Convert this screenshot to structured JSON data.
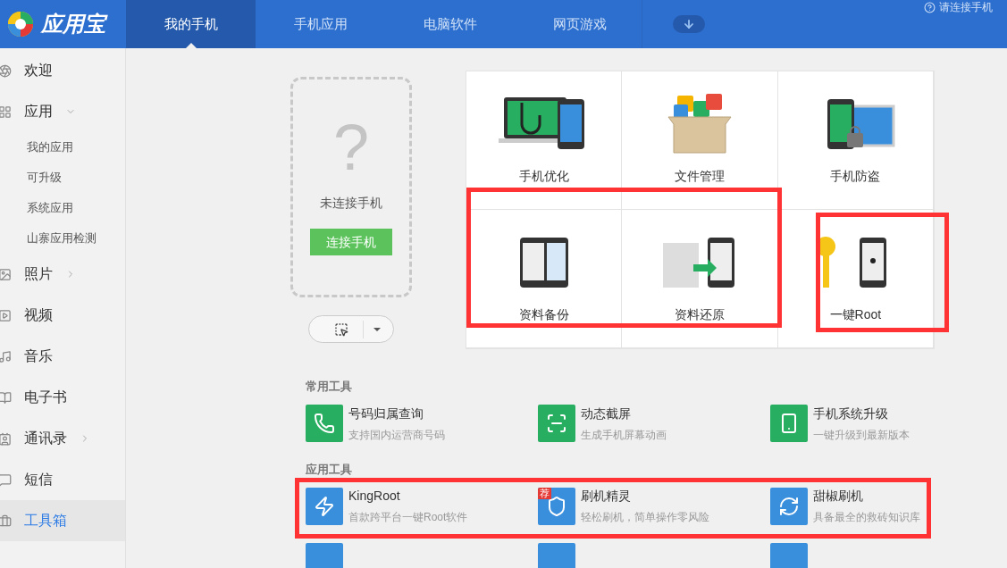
{
  "logo": {
    "text": "应用宝"
  },
  "tabs": [
    {
      "label": "我的手机",
      "selected": true
    },
    {
      "label": "手机应用",
      "selected": false
    },
    {
      "label": "电脑软件",
      "selected": false
    },
    {
      "label": "网页游戏",
      "selected": false
    }
  ],
  "header_right": {
    "text": "请连接手机"
  },
  "sidebar": {
    "items": [
      {
        "label": "欢迎",
        "selected": false
      },
      {
        "label": "应用",
        "selected": false,
        "expanded": true,
        "children": [
          {
            "label": "我的应用"
          },
          {
            "label": "可升级"
          },
          {
            "label": "系统应用"
          },
          {
            "label": "山寨应用检测"
          }
        ]
      },
      {
        "label": "照片",
        "selected": false,
        "expanded": false
      },
      {
        "label": "视频",
        "selected": false
      },
      {
        "label": "音乐",
        "selected": false
      },
      {
        "label": "电子书",
        "selected": false
      },
      {
        "label": "通讯录",
        "selected": false,
        "expanded": false
      },
      {
        "label": "短信",
        "selected": false
      },
      {
        "label": "工具箱",
        "selected": true
      }
    ]
  },
  "phone_card": {
    "symbol": "?",
    "status": "未连接手机",
    "connect_button": "连接手机"
  },
  "features": [
    {
      "label": "手机优化"
    },
    {
      "label": "文件管理"
    },
    {
      "label": "手机防盗"
    },
    {
      "label": "资料备份"
    },
    {
      "label": "资料还原"
    },
    {
      "label": "一键Root"
    }
  ],
  "sections": [
    {
      "title": "常用工具",
      "tools": [
        {
          "name": "号码归属查询",
          "description": "支持国内运营商号码",
          "color": "#27ae60"
        },
        {
          "name": "动态截屏",
          "description": "生成手机屏幕动画",
          "color": "#27ae60"
        },
        {
          "name": "手机系统升级",
          "description": "一键升级到最新版本",
          "color": "#27ae60"
        }
      ]
    },
    {
      "title": "应用工具",
      "tools": [
        {
          "name": "KingRoot",
          "description": "首款跨平台一键Root软件",
          "color": "#3a8fdd"
        },
        {
          "name": "刷机精灵",
          "description": "轻松刷机，简单操作零风险",
          "color": "#3a8fdd",
          "badge": "荐"
        },
        {
          "name": "甜椒刷机",
          "description": "具备最全的救砖知识库",
          "color": "#3a8fdd"
        }
      ]
    }
  ],
  "cut_off_tools": [
    {
      "color": "#3a8fdd"
    },
    {
      "color": "#3a8fdd"
    },
    {
      "color": "#3a8fdd"
    }
  ],
  "annotations": [
    {
      "color": "#ff3333"
    },
    {
      "color": "#ff3333"
    },
    {
      "color": "#ff3333"
    }
  ]
}
